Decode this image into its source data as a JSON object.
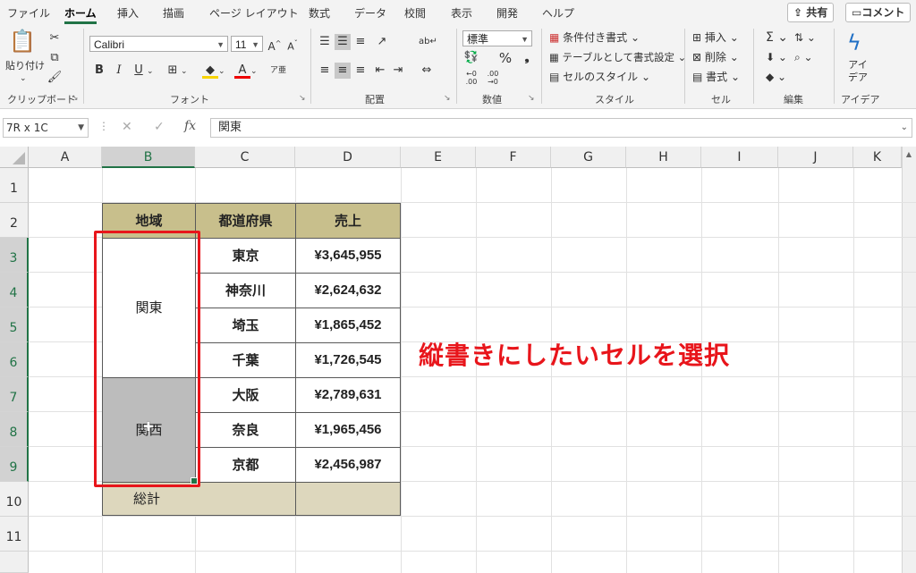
{
  "menu": {
    "tabs": [
      "ファイル",
      "ホーム",
      "挿入",
      "描画",
      "ページ レイアウト",
      "数式",
      "データ",
      "校閲",
      "表示",
      "開発",
      "ヘルプ"
    ],
    "active": "ホーム",
    "share": "共有",
    "comment": "コメント"
  },
  "ribbon": {
    "clipboard": {
      "paste": "貼り付け",
      "label": "クリップボード"
    },
    "font": {
      "name": "Calibri",
      "size": "11",
      "label": "フォント"
    },
    "alignment": {
      "label": "配置"
    },
    "number": {
      "format": "標準",
      "label": "数値"
    },
    "styles": {
      "conditional": "条件付き書式",
      "table": "テーブルとして書式設定",
      "cell_styles": "セルのスタイル",
      "label": "スタイル"
    },
    "cells": {
      "insert": "挿入",
      "delete": "削除",
      "format": "書式",
      "label": "セル"
    },
    "editing": {
      "label": "編集"
    },
    "ideas": {
      "button": "アイ\nデア",
      "label": "アイデア"
    }
  },
  "formula_bar": {
    "name_box": "7R x 1C",
    "content": "関東"
  },
  "grid": {
    "columns": [
      "A",
      "B",
      "C",
      "D",
      "E",
      "F",
      "G",
      "H",
      "I",
      "J",
      "K"
    ],
    "rows": [
      "1",
      "2",
      "3",
      "4",
      "5",
      "6",
      "7",
      "8",
      "9",
      "10",
      "11"
    ]
  },
  "table": {
    "headers": [
      "地域",
      "都道府県",
      "売上"
    ],
    "regions": [
      "関東",
      "関西"
    ],
    "rows": [
      {
        "pref": "東京",
        "sales": "¥3,645,955"
      },
      {
        "pref": "神奈川",
        "sales": "¥2,624,632"
      },
      {
        "pref": "埼玉",
        "sales": "¥1,865,452"
      },
      {
        "pref": "千葉",
        "sales": "¥1,726,545"
      },
      {
        "pref": "大阪",
        "sales": "¥2,789,631"
      },
      {
        "pref": "奈良",
        "sales": "¥1,965,456"
      },
      {
        "pref": "京都",
        "sales": "¥2,456,987"
      }
    ],
    "total_label": "総計"
  },
  "annotation": {
    "text": "縦書きにしたいセルを選択",
    "color": "#e8151b"
  },
  "colors": {
    "header_fill": "#c8bf8c",
    "total_fill": "#ddd7bd",
    "selection_fill": "#bcbcbc",
    "accent": "#217346"
  }
}
